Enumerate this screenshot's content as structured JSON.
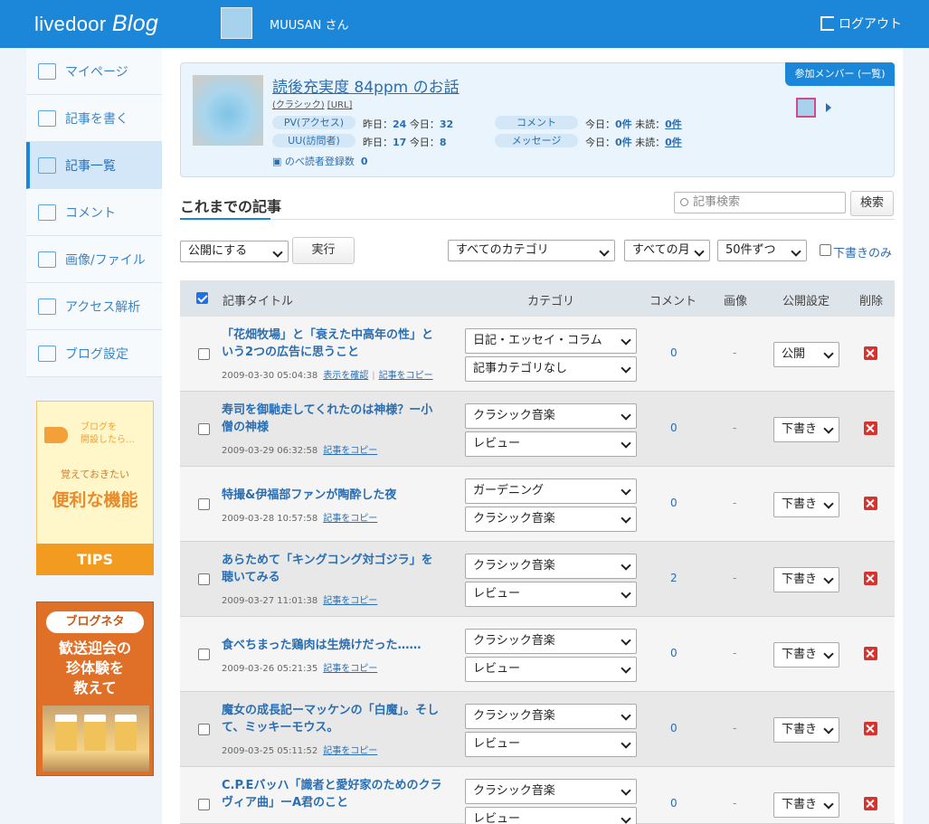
{
  "header": {
    "logo_main": "livedoor",
    "logo_blog": "Blog",
    "username": "MUUSAN さん",
    "logout": "ログアウト"
  },
  "sidebar": {
    "items": [
      {
        "label": "マイページ",
        "icon": "home-icon"
      },
      {
        "label": "記事を書く",
        "icon": "pencil-icon"
      },
      {
        "label": "記事一覧",
        "icon": "document-icon"
      },
      {
        "label": "コメント",
        "icon": "comment-icon"
      },
      {
        "label": "画像/ファイル",
        "icon": "image-icon"
      },
      {
        "label": "アクセス解析",
        "icon": "bar-chart-icon"
      },
      {
        "label": "ブログ設定",
        "icon": "wrench-icon"
      }
    ],
    "banner_tips": {
      "small1": "ブログを",
      "small2": "開設したら…",
      "mid": "覚えておきたい",
      "big": "便利な機能",
      "footer": "TIPS"
    },
    "banner_neta": {
      "pill": "ブログネタ",
      "line1": "歓送迎会の",
      "line2": "珍体験を",
      "line3": "教えて"
    }
  },
  "blog": {
    "title": "読後充実度 84ppm のお話",
    "tag": "(クラシック)",
    "url": "[URL]",
    "members_button": "参加メンバー (一覧)",
    "stats": {
      "pv_label": "PV(アクセス)",
      "pv_yesterday_label": "昨日：",
      "pv_yesterday": "24",
      "pv_today_label": "今日：",
      "pv_today": "32",
      "uu_label": "UU(訪問者)",
      "uu_yesterday_label": "昨日：",
      "uu_yesterday": "17",
      "uu_today_label": "今日：",
      "uu_today": "8",
      "comment_label": "コメント",
      "comment_today_label": "今日：",
      "comment_today": "0件",
      "comment_unread_label": "未読：",
      "comment_unread": "0件",
      "message_label": "メッセージ",
      "message_today_label": "今日：",
      "message_today": "0件",
      "message_unread_label": "未読：",
      "message_unread": "0件",
      "readers_label": "のべ読者登録数",
      "readers": "0"
    }
  },
  "section": {
    "title": "これまでの記事",
    "search_placeholder": "記事検索",
    "search_button": "検索"
  },
  "controls": {
    "bulk_action": "公開にする",
    "run_button": "実行",
    "category_filter": "すべてのカテゴリ",
    "month_filter": "すべての月",
    "per_page": "50件ずつ",
    "drafts_only": "下書きのみ"
  },
  "table": {
    "headers": {
      "title": "記事タイトル",
      "category": "カテゴリ",
      "comments": "コメント",
      "image": "画像",
      "publish": "公開設定",
      "delete": "削除"
    },
    "rows": [
      {
        "title": "「花畑牧場」と「衰えた中高年の性」という2つの広告に思うこと",
        "date": "2009-03-30 05:04:38",
        "link1": "表示を確認",
        "link2": "記事をコピー",
        "cat1": "日記・エッセイ・コラム",
        "cat2": "記事カテゴリなし",
        "comments": "0",
        "image": "-",
        "status": "公開"
      },
      {
        "title": "寿司を御馳走してくれたのは神様？ー小僧の神様",
        "date": "2009-03-29 06:32:58",
        "link1": "",
        "link2": "記事をコピー",
        "cat1": "クラシック音楽",
        "cat2": "レビュー",
        "comments": "0",
        "image": "-",
        "status": "下書き"
      },
      {
        "title": "特撮&伊福部ファンが陶酔した夜",
        "date": "2009-03-28 10:57:58",
        "link1": "",
        "link2": "記事をコピー",
        "cat1": "ガーデニング",
        "cat2": "クラシック音楽",
        "comments": "0",
        "image": "-",
        "status": "下書き"
      },
      {
        "title": "あらためて「キングコング対ゴジラ」を聴いてみる",
        "date": "2009-03-27 11:01:38",
        "link1": "",
        "link2": "記事をコピー",
        "cat1": "クラシック音楽",
        "cat2": "レビュー",
        "comments": "2",
        "image": "-",
        "status": "下書き"
      },
      {
        "title": "食べちまった鶏肉は生焼けだった……",
        "date": "2009-03-26 05:21:35",
        "link1": "",
        "link2": "記事をコピー",
        "cat1": "クラシック音楽",
        "cat2": "レビュー",
        "comments": "0",
        "image": "-",
        "status": "下書き"
      },
      {
        "title": "魔女の成長記ーマッケンの「白魔」。そして、ミッキーモウス。",
        "date": "2009-03-25 05:11:52",
        "link1": "",
        "link2": "記事をコピー",
        "cat1": "クラシック音楽",
        "cat2": "レビュー",
        "comments": "0",
        "image": "-",
        "status": "下書き"
      },
      {
        "title": "C.P.Eバッハ「識者と愛好家のためのクラヴィア曲」ーA君のこと",
        "date": "",
        "link1": "",
        "link2": "",
        "cat1": "クラシック音楽",
        "cat2": "レビュー",
        "comments": "0",
        "image": "-",
        "status": "下書き"
      }
    ]
  }
}
